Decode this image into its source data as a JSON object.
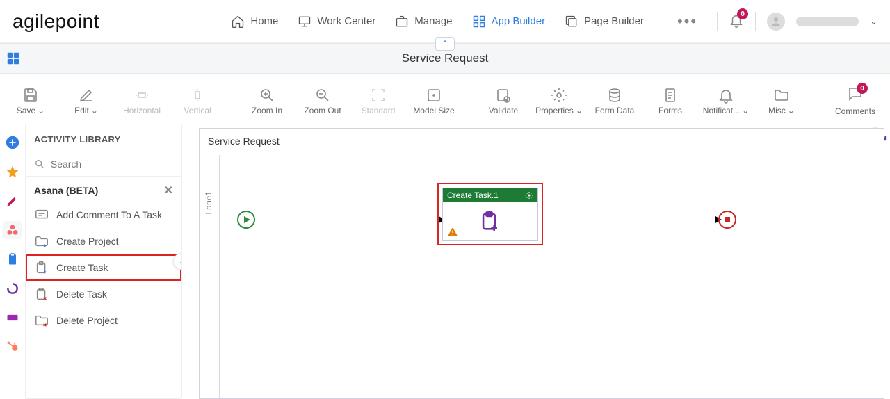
{
  "brand": "agilepoint",
  "nav": {
    "home": "Home",
    "work_center": "Work Center",
    "manage": "Manage",
    "app_builder": "App Builder",
    "page_builder": "Page Builder"
  },
  "notifications_count": "0",
  "page_title": "Service Request",
  "toolbar": {
    "save": "Save",
    "edit": "Edit",
    "horizontal": "Horizontal",
    "vertical": "Vertical",
    "zoom_in": "Zoom In",
    "zoom_out": "Zoom Out",
    "standard": "Standard",
    "model_size": "Model Size",
    "validate": "Validate",
    "properties": "Properties",
    "form_data": "Form Data",
    "forms": "Forms",
    "notifications": "Notificat...",
    "misc": "Misc",
    "comments": "Comments",
    "comments_count": "0"
  },
  "library": {
    "title": "ACTIVITY LIBRARY",
    "search_placeholder": "Search",
    "category": "Asana (BETA)",
    "items": {
      "add_comment": "Add Comment To A Task",
      "create_project": "Create Project",
      "create_task": "Create Task",
      "delete_task": "Delete Task",
      "delete_project": "Delete Project"
    }
  },
  "canvas": {
    "title": "Service Request",
    "lane": "Lane1",
    "task_title": "Create Task.1"
  }
}
